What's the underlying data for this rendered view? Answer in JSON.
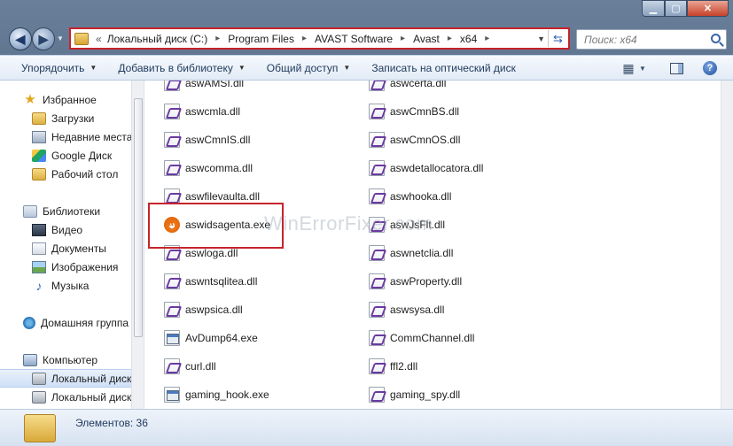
{
  "window": {
    "min_icon": "minimize-icon",
    "max_icon": "maximize-icon",
    "close_icon": "close-icon",
    "close_glyph": "✕"
  },
  "nav": {
    "back_glyph": "◀",
    "forward_glyph": "▶",
    "history_glyph": "▼"
  },
  "address": {
    "overflow": "«",
    "crumbs": [
      "Локальный диск (C:)",
      "Program Files",
      "AVAST Software",
      "Avast",
      "x64"
    ],
    "separator": "▸",
    "highlight_color": "#c6232b"
  },
  "search": {
    "placeholder": "Поиск: x64"
  },
  "toolbar": {
    "organize": "Упорядочить",
    "add_to_library": "Добавить в библиотеку",
    "share": "Общий доступ",
    "burn": "Записать на оптический диск"
  },
  "sidebar": {
    "favorites": "Избранное",
    "downloads": "Загрузки",
    "recent": "Недавние места",
    "google_drive": "Google Диск",
    "desktop": "Рабочий стол",
    "libraries": "Библиотеки",
    "video": "Видео",
    "documents": "Документы",
    "images": "Изображения",
    "music": "Музыка",
    "homegroup": "Домашняя группа",
    "computer": "Компьютер",
    "local_disk_1": "Локальный диск",
    "local_disk_2": "Локальный диск"
  },
  "files": {
    "left": [
      {
        "name": "aswAMSI.dll",
        "type": "dll"
      },
      {
        "name": "aswcmla.dll",
        "type": "dll"
      },
      {
        "name": "aswCmnIS.dll",
        "type": "dll"
      },
      {
        "name": "aswcomma.dll",
        "type": "dll"
      },
      {
        "name": "aswfilevaulta.dll",
        "type": "dll"
      },
      {
        "name": "aswidsagenta.exe",
        "type": "avast"
      },
      {
        "name": "aswloga.dll",
        "type": "dll"
      },
      {
        "name": "aswntsqlitea.dll",
        "type": "dll"
      },
      {
        "name": "aswpsica.dll",
        "type": "dll"
      },
      {
        "name": "AvDump64.exe",
        "type": "exe"
      },
      {
        "name": "curl.dll",
        "type": "dll"
      },
      {
        "name": "gaming_hook.exe",
        "type": "exe"
      }
    ],
    "right": [
      {
        "name": "aswcerta.dll",
        "type": "dll"
      },
      {
        "name": "aswCmnBS.dll",
        "type": "dll"
      },
      {
        "name": "aswCmnOS.dll",
        "type": "dll"
      },
      {
        "name": "aswdetallocatora.dll",
        "type": "dll"
      },
      {
        "name": "aswhooka.dll",
        "type": "dll"
      },
      {
        "name": "aswJsFlt.dll",
        "type": "dll"
      },
      {
        "name": "aswnetclia.dll",
        "type": "dll"
      },
      {
        "name": "aswProperty.dll",
        "type": "dll"
      },
      {
        "name": "aswsysa.dll",
        "type": "dll"
      },
      {
        "name": "CommChannel.dll",
        "type": "dll"
      },
      {
        "name": "ffl2.dll",
        "type": "dll"
      },
      {
        "name": "gaming_spy.dll",
        "type": "dll"
      }
    ],
    "selected_highlight": "aswidsagenta.exe"
  },
  "watermark": "WinErrorFixer.com",
  "status": {
    "items_count": "Элементов: 36"
  }
}
